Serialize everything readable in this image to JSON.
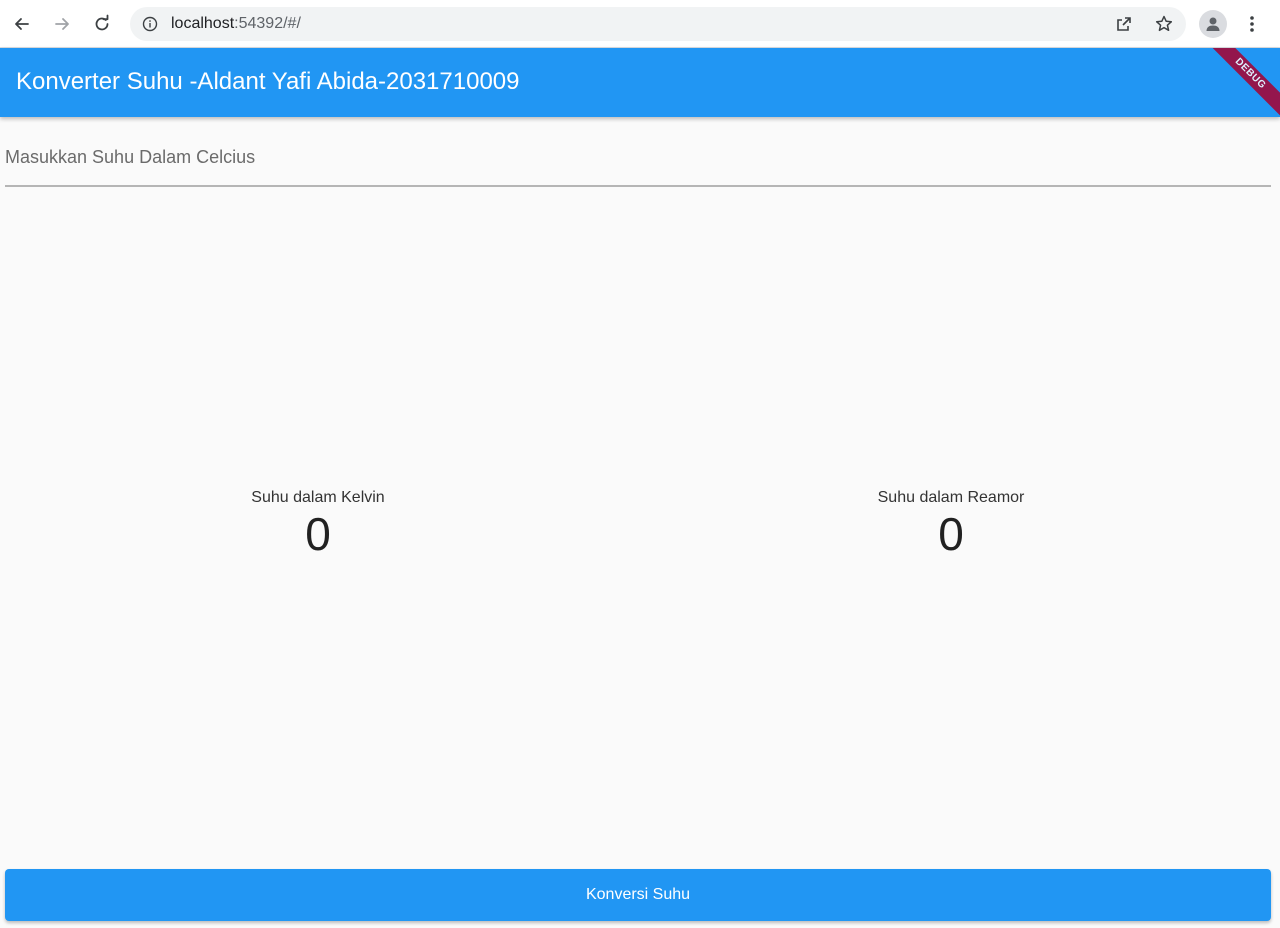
{
  "browser": {
    "url_host": "localhost",
    "url_rest": ":54392/#/"
  },
  "app": {
    "title": "Konverter Suhu -Aldant Yafi Abida-2031710009",
    "debug_banner": "DEBUG",
    "primary_color": "#2196f3",
    "input": {
      "placeholder": "Masukkan Suhu Dalam Celcius",
      "value": ""
    },
    "results": {
      "kelvin": {
        "label": "Suhu dalam Kelvin",
        "value": "0"
      },
      "reamor": {
        "label": "Suhu dalam Reamor",
        "value": "0"
      }
    },
    "convert_button": "Konversi Suhu"
  },
  "icons": [
    "back-icon",
    "forward-icon",
    "reload-icon",
    "info-icon",
    "share-icon",
    "star-icon",
    "profile-icon",
    "more-vert-icon"
  ]
}
